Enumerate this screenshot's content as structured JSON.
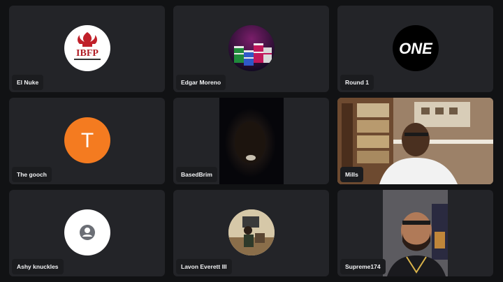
{
  "participants": [
    {
      "name": "El Nuke",
      "avatar_text": "IBFP"
    },
    {
      "name": "Edgar Moreno"
    },
    {
      "name": "Round 1",
      "avatar_text": "ONE"
    },
    {
      "name": "The gooch",
      "avatar_text": "T",
      "avatar_color": "#f47b20"
    },
    {
      "name": "BasedBrim"
    },
    {
      "name": "Mills"
    },
    {
      "name": "Ashy knuckles"
    },
    {
      "name": "Lavon Everett III"
    },
    {
      "name": "Supreme174"
    }
  ],
  "colors": {
    "background": "#111214",
    "tile": "#232428",
    "label_bg": "#1b1c1f",
    "label_text": "#f2f3f5"
  }
}
